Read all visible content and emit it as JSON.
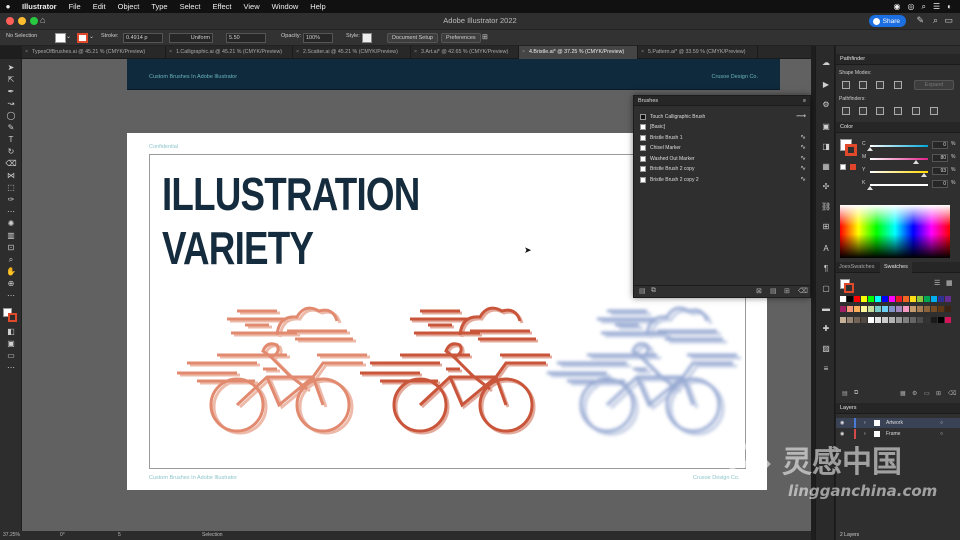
{
  "menubar": {
    "app": "Illustrator",
    "items": [
      "File",
      "Edit",
      "Object",
      "Type",
      "Select",
      "Effect",
      "View",
      "Window",
      "Help"
    ]
  },
  "window": {
    "title": "Adobe Illustrator 2022",
    "share_label": "Share"
  },
  "control_bar": {
    "selection": "No Selection",
    "stroke_label": "Stroke:",
    "stroke_value": "0.4914 p",
    "profile": "Uniform",
    "brush_size": "5.50",
    "opacity_label": "Opacity:",
    "opacity_value": "100%",
    "style_label": "Style:",
    "document_setup": "Document Setup",
    "preferences": "Preferences"
  },
  "tabs": [
    {
      "label": "TypesOfBrushes.ai @ 45.21 % (CMYK/Preview)",
      "active": false
    },
    {
      "label": "1.Calligraphic.ai @ 45.21 % (CMYK/Preview)",
      "active": false
    },
    {
      "label": "2.Scatter.ai @ 45.21 % (CMYK/Preview)",
      "active": false
    },
    {
      "label": "3.Art.ai* @ 42.65 % (CMYK/Preview)",
      "active": false
    },
    {
      "label": "4.Bristle.ai* @ 37.25 % (CMYK/Preview)",
      "active": true
    },
    {
      "label": "5.Pattern.ai* @ 33.59 % (CMYK/Preview)",
      "active": false
    }
  ],
  "canvas": {
    "top_board_left": "Custom Brushes In Adobe Illustrator",
    "top_board_right": "Crusoe Design Co.",
    "confidential": "Confidential",
    "headline_1": "ILLUSTRATION",
    "headline_2": "VARIETY",
    "footer_left": "Custom Brushes In Adobe Illustrator",
    "footer_right": "Crusoe Design Co."
  },
  "status_bar": {
    "zoom": "37.25%",
    "rotation": "0°",
    "artboard": "5",
    "tool": "Selection"
  },
  "brushes_panel": {
    "title": "Brushes",
    "items": [
      {
        "label": "Touch Calligraphic Brush",
        "stroke": "⟿"
      },
      {
        "label": "[Basic]",
        "stroke": ""
      },
      {
        "label": "Bristle Brush 1",
        "stroke": "∿"
      },
      {
        "label": "Chisel Marker",
        "stroke": "∿"
      },
      {
        "label": "Washed Out Marker",
        "stroke": "∿"
      },
      {
        "label": "Bristle Brush 2 copy",
        "stroke": "∿"
      },
      {
        "label": "Bristle Brush 2 copy 2",
        "stroke": "∿"
      }
    ]
  },
  "pathfinder_panel": {
    "title": "Pathfinder",
    "shape_modes": "Shape Modes:",
    "pathfinders": "Pathfinders:",
    "expand": "Expand"
  },
  "color_panel": {
    "title": "Color",
    "channels": [
      {
        "label": "C",
        "value": "0",
        "color": "#00a8d8",
        "level": 0.0
      },
      {
        "label": "M",
        "value": "80",
        "color": "#e0218a",
        "level": 0.8
      },
      {
        "label": "Y",
        "value": "93",
        "color": "#ffd800",
        "level": 0.93
      },
      {
        "label": "K",
        "value": "0",
        "color": "#ffffff",
        "level": 0.0
      }
    ],
    "unit": "%"
  },
  "swatches_panel": {
    "tab_inactive": "JoesSwatches",
    "tab_active": "Swatches",
    "colors": [
      "#ffffff",
      "#000000",
      "#ff0000",
      "#ffff00",
      "#00ff00",
      "#00ffff",
      "#0000ff",
      "#ff00ff",
      "#ed1c24",
      "#f26522",
      "#ffde17",
      "#8dc63f",
      "#00a651",
      "#00aeef",
      "#2e3192",
      "#662d91",
      "#9e1f63",
      "#f7977a",
      "#fbaf5d",
      "#fff799",
      "#c4df9b",
      "#7accc8",
      "#6dcff6",
      "#8393ca",
      "#a187be",
      "#f49ac1",
      "#c69c6d",
      "#a67c52",
      "#8c6239",
      "#754c24",
      "#603813",
      "#3c2415",
      "#c7b299",
      "#998675",
      "#736357",
      "#534741",
      "#ffffff",
      "#e6e6e6",
      "#cccccc",
      "#b3b3b3",
      "#999999",
      "#808080",
      "#666666",
      "#4d4d4d",
      "#333333",
      "#1a1a1a",
      "#000000",
      "#d4145a"
    ]
  },
  "layers_panel": {
    "title": "Layers",
    "layers": [
      {
        "name": "Artwork",
        "color": "#4a7bd4"
      },
      {
        "name": "Frame",
        "color": "#d44a4a"
      }
    ],
    "footer": "2 Layers"
  },
  "watermark": {
    "cn": "灵感中国",
    "url": "lingganchina.com"
  }
}
